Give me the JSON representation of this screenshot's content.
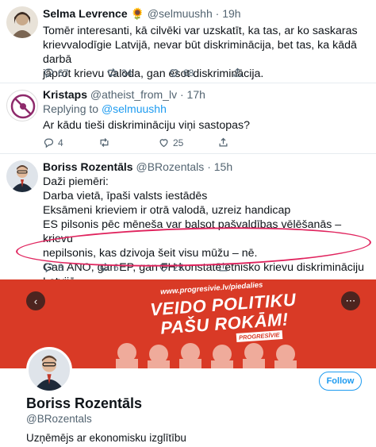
{
  "tweets": [
    {
      "name": "Selma Levrence",
      "emoji": "🌻",
      "handle": "@selmuushh",
      "time": "19h",
      "lines": [
        "Tomēr interesanti, kā cilvēki var uzskatīt, ka tas, ar ko saskaras",
        "krievvalodīgie Latvijā, nevar būt diskriminācija, bet tas, ka kādā darbā",
        "jāprot krievu valoda, gan esot diskriminācija."
      ],
      "replies": "67",
      "retweets": "34",
      "likes": "68"
    },
    {
      "name": "Kristaps",
      "handle": "@atheist_from_lv",
      "time": "17h",
      "replying_prefix": "Replying to",
      "replying_handle": "@selmuushh",
      "lines": [
        "Ar kādu tieši diskrimināciju viņi sastopas?"
      ],
      "replies": "4",
      "retweets": "",
      "likes": "25"
    },
    {
      "name": "Boriss Rozentāls",
      "handle": "@BRozentals",
      "time": "15h",
      "lines": [
        "Daži piemēri:",
        "Darba vietā, īpaši valsts iestādēs",
        "Eksāmeni krieviem ir otrā valodā, uzreiz handicap",
        "ES pilsonis pēc mēneša var balsot pašvaldības vēlēšanās – krievu",
        "nepilsonis, kas dzivoja šeit visu mūžu – nē.",
        "Gan ANO, gan EP, gan FH konstatē etnisko krievu diskrimināciju Latvijā"
      ],
      "replies": "8",
      "retweets": "6",
      "likes": "25"
    }
  ],
  "profile_card": {
    "banner_url": "www.progresivie.lv/piedalies",
    "banner_line1": "VEIDO POLITIKU",
    "banner_line2": "PAŠU ROKĀM!",
    "banner_tag": "PROGRESĪVIE",
    "name": "Boriss Rozentāls",
    "handle": "@BRozentals",
    "bio": "Uzņēmējs ar ekonomisku izglītību",
    "follow_label": "Follow"
  },
  "colors": {
    "accent": "#1d9bf0",
    "banner": "#d93a26",
    "highlight": "#e0245e"
  }
}
